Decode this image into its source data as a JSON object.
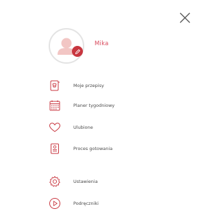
{
  "profile": {
    "username": "Mika"
  },
  "menu": {
    "items": [
      {
        "label": "Moje przepisy",
        "icon": "recipe-book-icon"
      },
      {
        "label": "Planer tygodniowy",
        "icon": "calendar-icon"
      },
      {
        "label": "Ulubione",
        "icon": "heart-icon"
      },
      {
        "label": "Proces gotowania",
        "icon": "clipboard-icon"
      },
      {
        "label": "Ustawienia",
        "icon": "gear-icon"
      },
      {
        "label": "Podręczniki",
        "icon": "play-icon"
      }
    ]
  },
  "colors": {
    "accent": "#c8363f",
    "username": "#d94a5c",
    "avatar": "#f2c6c4",
    "text": "#4a4a4a"
  }
}
